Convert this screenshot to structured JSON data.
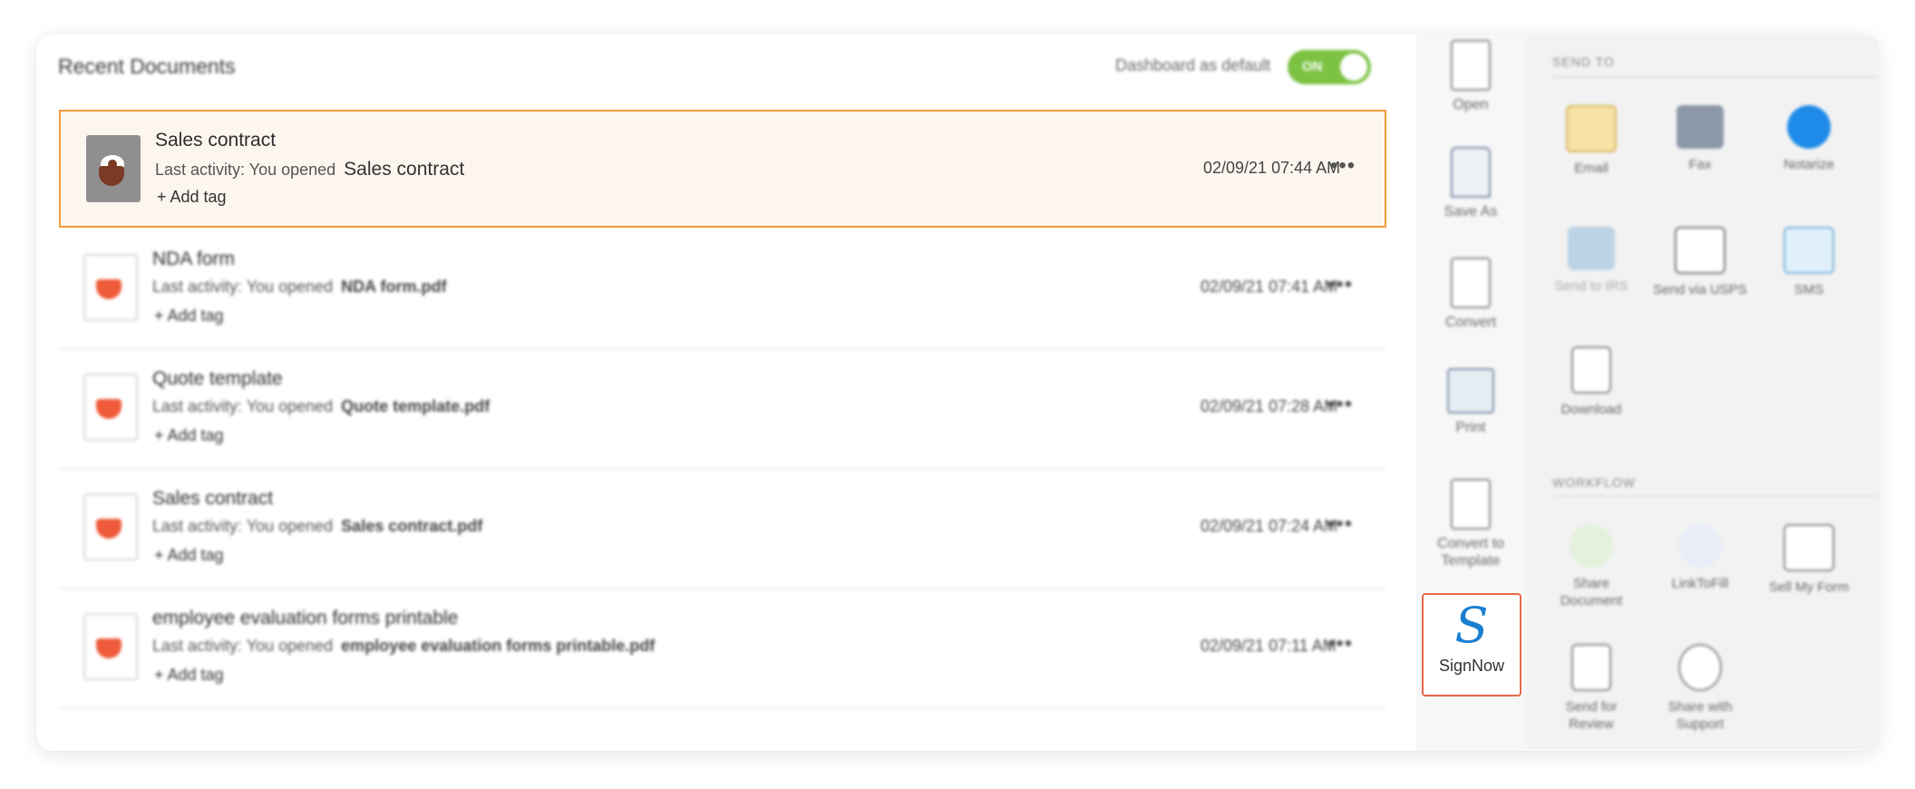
{
  "recent": {
    "title": "Recent Documents",
    "dashboard_label": "Dashboard as default",
    "toggle_label": "ON"
  },
  "documents": [
    {
      "title": "Sales contract",
      "activity_prefix": "Last activity: You opened",
      "file": "Sales contract",
      "tag": "+ Add tag",
      "date": "02/09/21 07:44 AM"
    },
    {
      "title": "NDA form",
      "activity_prefix": "Last activity: You opened",
      "file": "NDA form.pdf",
      "tag": "+ Add tag",
      "date": "02/09/21 07:41 AM"
    },
    {
      "title": "Quote template",
      "activity_prefix": "Last activity: You opened",
      "file": "Quote template.pdf",
      "tag": "+ Add tag",
      "date": "02/09/21 07:28 AM"
    },
    {
      "title": "Sales contract",
      "activity_prefix": "Last activity: You opened",
      "file": "Sales contract.pdf",
      "tag": "+ Add tag",
      "date": "02/09/21 07:24 AM"
    },
    {
      "title": "employee evaluation forms printable",
      "activity_prefix": "Last activity: You opened",
      "file": "employee evaluation forms printable.pdf",
      "tag": "+ Add tag",
      "date": "02/09/21 07:11 AM"
    }
  ],
  "more_glyph": "•••",
  "tools": {
    "open": "Open",
    "save_as": "Save As",
    "convert": "Convert",
    "print": "Print",
    "convert_template": "Convert to Template",
    "signnow": "SignNow",
    "signnow_glyph": "S"
  },
  "send_to": {
    "title": "SEND TO",
    "email": "Email",
    "fax": "Fax",
    "notarize": "Notarize",
    "send_irs": "Send to IRS",
    "send_usps": "Send via USPS",
    "sms": "SMS",
    "download": "Download"
  },
  "workflow": {
    "title": "WORKFLOW",
    "share_document": "Share Document",
    "linktofill": "LinkToFill",
    "sell_form": "Sell My Form",
    "send_review": "Send for Review",
    "share_support": "Share with Support"
  },
  "colors": {
    "accent_orange": "#f39a3b",
    "toggle_green": "#7cc243",
    "signnow_blue": "#1a7fd1"
  }
}
